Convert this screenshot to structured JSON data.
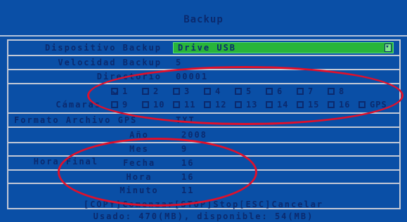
{
  "title": "Backup",
  "rows": {
    "device": {
      "label": "Dispositivo Backup",
      "value": "Drive USB"
    },
    "speed": {
      "label": "Velocidad Backup",
      "value": "5"
    },
    "directory": {
      "label": "Directorio",
      "value": "00001"
    },
    "cameras": {
      "label": "Cámaras",
      "items": [
        {
          "label": "1",
          "checked": true
        },
        {
          "label": "2",
          "checked": false
        },
        {
          "label": "3",
          "checked": false
        },
        {
          "label": "4",
          "checked": false
        },
        {
          "label": "5",
          "checked": false
        },
        {
          "label": "6",
          "checked": false
        },
        {
          "label": "7",
          "checked": false
        },
        {
          "label": "8",
          "checked": false
        },
        {
          "label": "9",
          "checked": false
        },
        {
          "label": "10",
          "checked": false
        },
        {
          "label": "11",
          "checked": false
        },
        {
          "label": "12",
          "checked": false
        },
        {
          "label": "13",
          "checked": false
        },
        {
          "label": "14",
          "checked": false
        },
        {
          "label": "15",
          "checked": false
        },
        {
          "label": "16",
          "checked": false
        },
        {
          "label": "GPS",
          "checked": false
        }
      ]
    },
    "format": {
      "label": "Formato Archivo GPS",
      "value": "TXT"
    },
    "end_time": {
      "label": "Hora Final",
      "fields": [
        {
          "label": "Año",
          "value": "2008"
        },
        {
          "label": "Mes",
          "value": "9"
        },
        {
          "label": "Fecha",
          "value": "16"
        },
        {
          "label": "Hora",
          "value": "16"
        },
        {
          "label": "Minuto",
          "value": "11"
        }
      ]
    }
  },
  "footer": {
    "keys": "[COPY]Comenzar[STOP]Stop[ESC]Cancelar",
    "usage": "Usado: 470(MB), disponible: 54(MB)"
  },
  "colors": {
    "background": "#0a4fa6",
    "text": "#0b2a6e",
    "dropdown": "#28b53a",
    "annotation": "#e0102b"
  }
}
